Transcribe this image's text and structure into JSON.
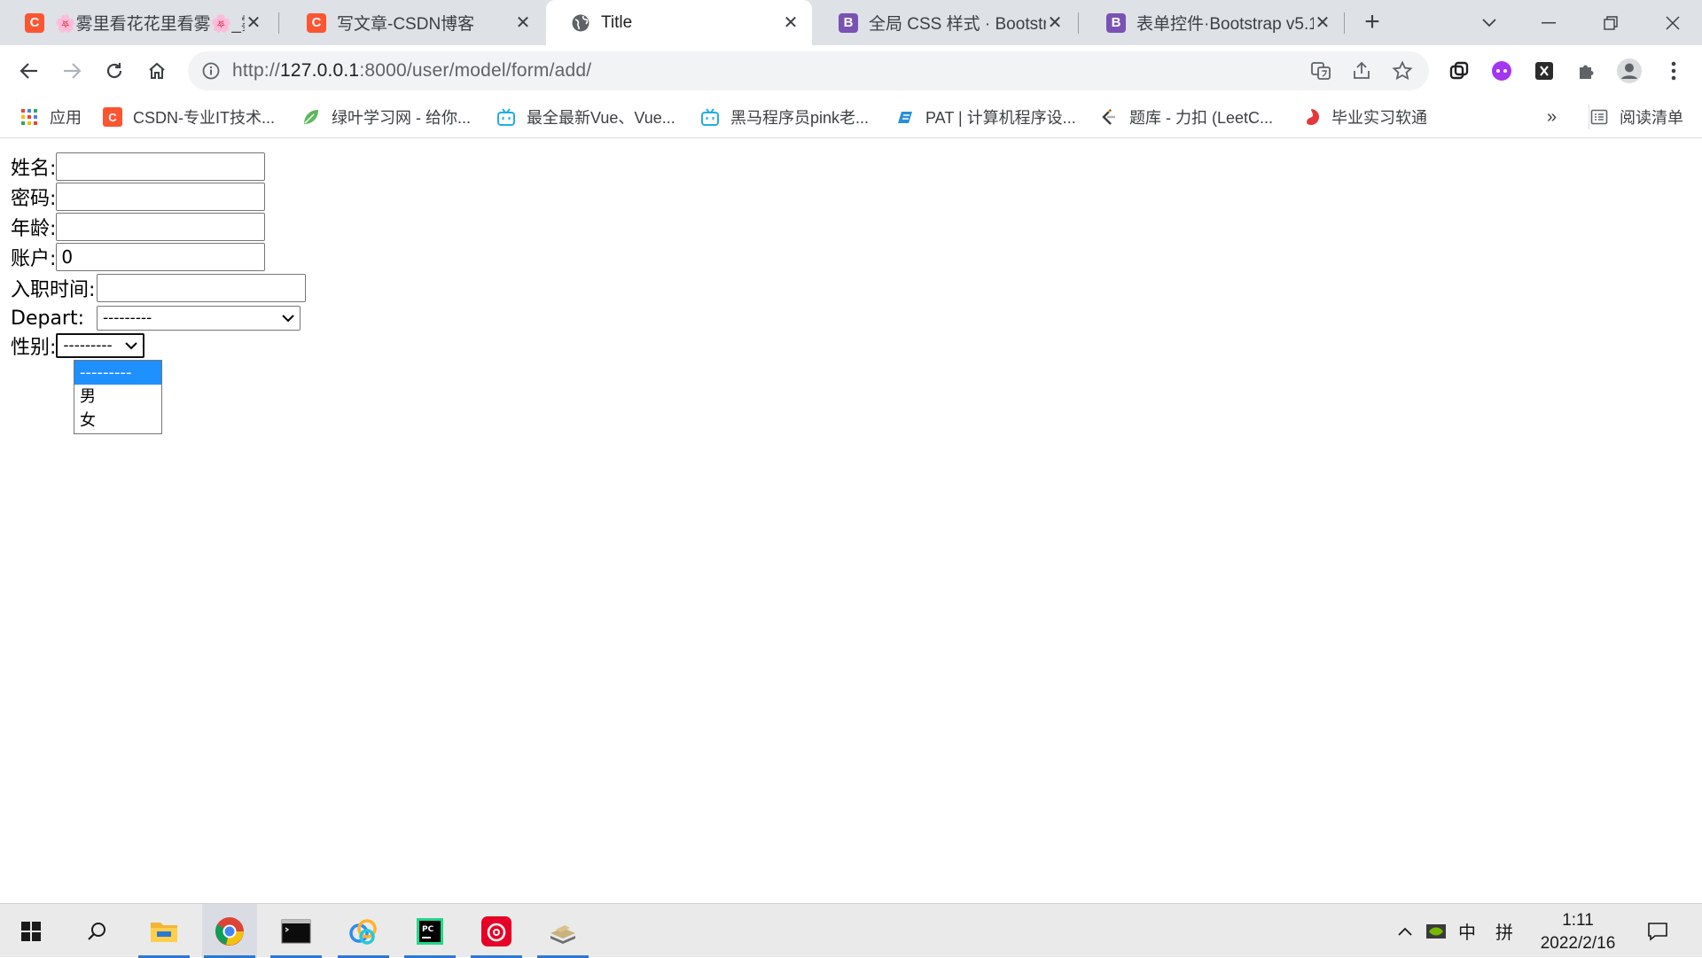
{
  "browser": {
    "tabs": [
      {
        "title": "🌸雾里看花花里看雾🌸_雾",
        "icon": "csdn-icon"
      },
      {
        "title": "写文章-CSDN博客",
        "icon": "csdn-icon"
      },
      {
        "title": "Title",
        "icon": "globe-icon"
      },
      {
        "title": "全局 CSS 样式 · Bootstrap",
        "icon": "bootstrap-icon"
      },
      {
        "title": "表单控件·Bootstrap v5.1",
        "icon": "bootstrap-icon"
      }
    ],
    "url_prefix": "http://",
    "url_host": "127.0.0.1",
    "url_path": ":8000/user/model/form/add/"
  },
  "bookmarks": {
    "apps_label": "应用",
    "items": [
      {
        "label": "CSDN-专业IT技术...",
        "icon": "csdn-icon"
      },
      {
        "label": "绿叶学习网 - 给你...",
        "icon": "leaf-icon"
      },
      {
        "label": "最全最新Vue、Vue...",
        "icon": "bilibili-icon"
      },
      {
        "label": "黑马程序员pink老...",
        "icon": "bilibili-icon"
      },
      {
        "label": "PAT | 计算机程序设...",
        "icon": "pat-icon"
      },
      {
        "label": "题库 - 力扣 (LeetC...",
        "icon": "leetcode-icon"
      },
      {
        "label": "毕业实习软通",
        "icon": "softcom-icon"
      }
    ],
    "more": "»",
    "reading_list": "阅读清单"
  },
  "form": {
    "name_label": "姓名:",
    "password_label": "密码:",
    "age_label": "年龄:",
    "account_label": "账户:",
    "account_value": "0",
    "create_time_label": "入职时间:",
    "depart_label": "Depart:",
    "depart_value": "---------",
    "gender_label": "性别:",
    "gender_value": "---------",
    "gender_options": [
      "---------",
      "男",
      "女"
    ]
  },
  "taskbar": {
    "ime_mode": "中",
    "ime_layout": "拼",
    "time": "1:11",
    "date": "2022/2/16"
  },
  "colors": {
    "accent": "#1e90ff",
    "csdn": "#fc5531",
    "bootstrap": "#7952b3"
  }
}
